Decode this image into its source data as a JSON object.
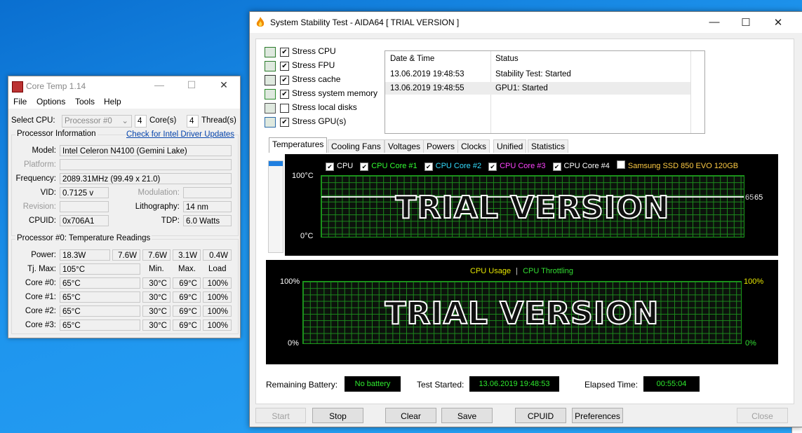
{
  "coretemp": {
    "title": "Core Temp 1.14",
    "menu": [
      "File",
      "Options",
      "Tools",
      "Help"
    ],
    "select_cpu_label": "Select CPU:",
    "select_cpu_value": "Processor #0",
    "cores_count": "4",
    "cores_label": "Core(s)",
    "threads_count": "4",
    "threads_label": "Thread(s)",
    "proc_info_label": "Processor Information",
    "driver_link": "Check for Intel Driver Updates",
    "model_label": "Model:",
    "model_value": "Intel Celeron N4100 (Gemini Lake)",
    "platform_label": "Platform:",
    "frequency_label": "Frequency:",
    "frequency_value": "2089.31MHz (99.49 x 21.0)",
    "vid_label": "VID:",
    "vid_value": "0.7125 v",
    "modulation_label": "Modulation:",
    "revision_label": "Revision:",
    "lithography_label": "Lithography:",
    "lithography_value": "14 nm",
    "cpuid_label": "CPUID:",
    "cpuid_value": "0x706A1",
    "tdp_label": "TDP:",
    "tdp_value": "6.0 Watts",
    "temps_label": "Processor #0: Temperature Readings",
    "power_label": "Power:",
    "power_values": [
      "18.3W",
      "7.6W",
      "7.6W",
      "3.1W",
      "0.4W"
    ],
    "tjmax_label": "Tj. Max:",
    "tjmax_value": "105°C",
    "col_min": "Min.",
    "col_max": "Max.",
    "col_load": "Load",
    "cores": [
      {
        "label": "Core #0:",
        "temp": "65°C",
        "min": "30°C",
        "max": "69°C",
        "load": "100%"
      },
      {
        "label": "Core #1:",
        "temp": "65°C",
        "min": "30°C",
        "max": "69°C",
        "load": "100%"
      },
      {
        "label": "Core #2:",
        "temp": "65°C",
        "min": "30°C",
        "max": "69°C",
        "load": "100%"
      },
      {
        "label": "Core #3:",
        "temp": "65°C",
        "min": "30°C",
        "max": "69°C",
        "load": "100%"
      }
    ]
  },
  "aida": {
    "title": "System Stability Test - AIDA64  [ TRIAL VERSION ]",
    "stress": [
      {
        "label": "Stress CPU",
        "checked": true,
        "icon": "cpu-chip-icon"
      },
      {
        "label": "Stress FPU",
        "checked": true,
        "icon": "fpu-icon"
      },
      {
        "label": "Stress cache",
        "checked": true,
        "icon": "cache-icon"
      },
      {
        "label": "Stress system memory",
        "checked": true,
        "icon": "memory-icon"
      },
      {
        "label": "Stress local disks",
        "checked": false,
        "icon": "disk-icon"
      },
      {
        "label": "Stress GPU(s)",
        "checked": true,
        "icon": "gpu-monitor-icon"
      }
    ],
    "log_headers": [
      "Date & Time",
      "Status"
    ],
    "log_rows": [
      {
        "time": "13.06.2019 19:48:53",
        "status": "Stability Test: Started"
      },
      {
        "time": "13.06.2019 19:48:55",
        "status": "GPU1: Started"
      }
    ],
    "tabs": [
      "Temperatures",
      "Cooling Fans",
      "Voltages",
      "Powers",
      "Clocks",
      "Unified",
      "Statistics"
    ],
    "active_tab": "Temperatures",
    "temp_legend": [
      {
        "label": "CPU",
        "checked": true,
        "color": "#ffffff"
      },
      {
        "label": "CPU Core #1",
        "checked": true,
        "color": "#33ff33"
      },
      {
        "label": "CPU Core #2",
        "checked": true,
        "color": "#33ddff"
      },
      {
        "label": "CPU Core #3",
        "checked": true,
        "color": "#ff44ff"
      },
      {
        "label": "CPU Core #4",
        "checked": true,
        "color": "#ffffff"
      },
      {
        "label": "Samsung SSD 850 EVO 120GB",
        "checked": false,
        "color": "#ffcc44"
      }
    ],
    "temp_axis_top": "100°C",
    "temp_axis_bottom": "0°C",
    "temp_reading_a": "65",
    "temp_reading_b": "65",
    "watermark": "TRIAL VERSION",
    "usage_legend_a": "CPU Usage",
    "usage_legend_sep": "|",
    "usage_legend_b": "CPU Throttling",
    "usage_axis_top_left": "100%",
    "usage_axis_bottom_left": "0%",
    "usage_axis_top_right": "100%",
    "usage_axis_bottom_right": "0%",
    "remaining_battery_label": "Remaining Battery:",
    "remaining_battery_value": "No battery",
    "test_started_label": "Test Started:",
    "test_started_value": "13.06.2019 19:48:53",
    "elapsed_label": "Elapsed Time:",
    "elapsed_value": "00:55:04",
    "buttons": {
      "start": "Start",
      "stop": "Stop",
      "clear": "Clear",
      "save": "Save",
      "cpuid": "CPUID",
      "preferences": "Preferences",
      "close": "Close"
    },
    "colors": {
      "graph_green": "#1c8a1c",
      "status_green": "#2eea2e",
      "usage_yellow": "#e6e600"
    }
  }
}
